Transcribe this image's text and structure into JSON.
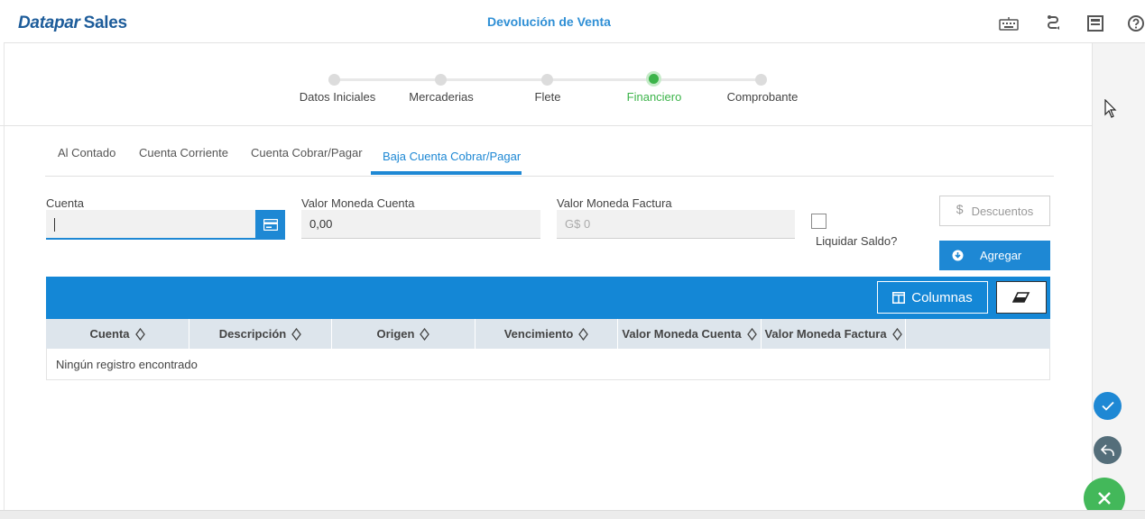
{
  "app": {
    "brand_part1": "Datapar",
    "brand_part2": "Sales",
    "title": "Devolución de Venta"
  },
  "header_icons": [
    "keyboard-icon",
    "link-icon",
    "save-icon",
    "help-icon"
  ],
  "stepper": {
    "steps": [
      {
        "label": "Datos Iniciales",
        "active": false
      },
      {
        "label": "Mercaderias",
        "active": false
      },
      {
        "label": "Flete",
        "active": false
      },
      {
        "label": "Financiero",
        "active": true
      },
      {
        "label": "Comprobante",
        "active": false
      }
    ]
  },
  "tabs": [
    {
      "label": "Al Contado",
      "active": false
    },
    {
      "label": "Cuenta Corriente",
      "active": false
    },
    {
      "label": "Cuenta Cobrar/Pagar",
      "active": false
    },
    {
      "label": "Baja Cuenta Cobrar/Pagar",
      "active": true
    }
  ],
  "form": {
    "cuenta_label": "Cuenta",
    "cuenta_value": "",
    "valor_moneda_cuenta_label": "Valor Moneda Cuenta",
    "valor_moneda_cuenta_value": "0,00",
    "valor_moneda_factura_label": "Valor Moneda Factura",
    "valor_moneda_factura_value": "G$ 0",
    "liquidar_saldo_label": "Liquidar Saldo?",
    "liquidar_saldo_checked": false,
    "descuentos_label": "Descuentos",
    "descuentos_icon": "$",
    "agregar_label": "Agregar"
  },
  "table": {
    "columnas_label": "Columnas",
    "columns": [
      "Cuenta",
      "Descripción",
      "Origen",
      "Vencimiento",
      "Valor Moneda Cuenta",
      "Valor Moneda Factura"
    ],
    "empty_message": "Ningún registro encontrado"
  },
  "colors": {
    "primary": "#1e88d4",
    "brand": "#1d5c9a",
    "success": "#3cb44a",
    "confirm": "#1e88d4",
    "back": "#546e7a",
    "close": "#43b85a"
  }
}
